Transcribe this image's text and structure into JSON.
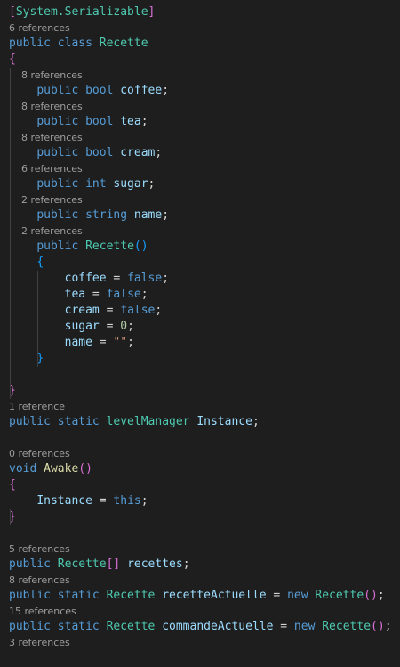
{
  "colors": {
    "background": "#1e1e1e",
    "keyword": "#569cd6",
    "type": "#4ec9b0",
    "function": "#dcdcaa",
    "identifier": "#9cdcfe",
    "punctuation": "#d4d4d4",
    "number": "#b5cea8",
    "string": "#ce9178",
    "codelens": "#9d9d9d",
    "bracket_level1": "#da70d6",
    "bracket_level2": "#179fff",
    "bracket_level3": "#ffd700"
  },
  "lines": [
    {
      "kind": "code",
      "tokens": [
        {
          "t": "[",
          "c": "br1"
        },
        {
          "t": "System.Serializable",
          "c": "ty"
        },
        {
          "t": "]",
          "c": "br1"
        }
      ]
    },
    {
      "kind": "lens",
      "text": "6 references"
    },
    {
      "kind": "code",
      "tokens": [
        {
          "t": "public class ",
          "c": "kw"
        },
        {
          "t": "Recette",
          "c": "ty"
        }
      ]
    },
    {
      "kind": "code",
      "tokens": [
        {
          "t": "{",
          "c": "br1"
        }
      ]
    },
    {
      "kind": "lens",
      "text": "    8 references"
    },
    {
      "kind": "code",
      "tokens": [
        {
          "t": "    ",
          "c": "pn"
        },
        {
          "t": "public bool ",
          "c": "kw"
        },
        {
          "t": "coffee",
          "c": "id"
        },
        {
          "t": ";",
          "c": "pn"
        }
      ]
    },
    {
      "kind": "lens",
      "text": "    8 references"
    },
    {
      "kind": "code",
      "tokens": [
        {
          "t": "    ",
          "c": "pn"
        },
        {
          "t": "public bool ",
          "c": "kw"
        },
        {
          "t": "tea",
          "c": "id"
        },
        {
          "t": ";",
          "c": "pn"
        }
      ]
    },
    {
      "kind": "lens",
      "text": "    8 references"
    },
    {
      "kind": "code",
      "tokens": [
        {
          "t": "    ",
          "c": "pn"
        },
        {
          "t": "public bool ",
          "c": "kw"
        },
        {
          "t": "cream",
          "c": "id"
        },
        {
          "t": ";",
          "c": "pn"
        }
      ]
    },
    {
      "kind": "lens",
      "text": "    6 references"
    },
    {
      "kind": "code",
      "tokens": [
        {
          "t": "    ",
          "c": "pn"
        },
        {
          "t": "public int ",
          "c": "kw"
        },
        {
          "t": "sugar",
          "c": "id"
        },
        {
          "t": ";",
          "c": "pn"
        }
      ]
    },
    {
      "kind": "lens",
      "text": "    2 references"
    },
    {
      "kind": "code",
      "tokens": [
        {
          "t": "    ",
          "c": "pn"
        },
        {
          "t": "public string ",
          "c": "kw"
        },
        {
          "t": "name",
          "c": "id"
        },
        {
          "t": ";",
          "c": "pn"
        }
      ]
    },
    {
      "kind": "lens",
      "text": "    2 references"
    },
    {
      "kind": "code",
      "tokens": [
        {
          "t": "    ",
          "c": "pn"
        },
        {
          "t": "public ",
          "c": "kw"
        },
        {
          "t": "Recette",
          "c": "ty"
        },
        {
          "t": "()",
          "c": "br2"
        }
      ]
    },
    {
      "kind": "code",
      "tokens": [
        {
          "t": "    ",
          "c": "pn"
        },
        {
          "t": "{",
          "c": "br2"
        }
      ]
    },
    {
      "kind": "code",
      "tokens": [
        {
          "t": "        ",
          "c": "pn"
        },
        {
          "t": "coffee",
          "c": "id"
        },
        {
          "t": " = ",
          "c": "pn"
        },
        {
          "t": "false",
          "c": "kw"
        },
        {
          "t": ";",
          "c": "pn"
        }
      ]
    },
    {
      "kind": "code",
      "tokens": [
        {
          "t": "        ",
          "c": "pn"
        },
        {
          "t": "tea",
          "c": "id"
        },
        {
          "t": " = ",
          "c": "pn"
        },
        {
          "t": "false",
          "c": "kw"
        },
        {
          "t": ";",
          "c": "pn"
        }
      ]
    },
    {
      "kind": "code",
      "tokens": [
        {
          "t": "        ",
          "c": "pn"
        },
        {
          "t": "cream",
          "c": "id"
        },
        {
          "t": " = ",
          "c": "pn"
        },
        {
          "t": "false",
          "c": "kw"
        },
        {
          "t": ";",
          "c": "pn"
        }
      ]
    },
    {
      "kind": "code",
      "tokens": [
        {
          "t": "        ",
          "c": "pn"
        },
        {
          "t": "sugar",
          "c": "id"
        },
        {
          "t": " = ",
          "c": "pn"
        },
        {
          "t": "0",
          "c": "num"
        },
        {
          "t": ";",
          "c": "pn"
        }
      ]
    },
    {
      "kind": "code",
      "tokens": [
        {
          "t": "        ",
          "c": "pn"
        },
        {
          "t": "name",
          "c": "id"
        },
        {
          "t": " = ",
          "c": "pn"
        },
        {
          "t": "\"\"",
          "c": "str"
        },
        {
          "t": ";",
          "c": "pn"
        }
      ]
    },
    {
      "kind": "code",
      "tokens": [
        {
          "t": "    ",
          "c": "pn"
        },
        {
          "t": "}",
          "c": "br2"
        }
      ]
    },
    {
      "kind": "code",
      "tokens": []
    },
    {
      "kind": "code",
      "tokens": [
        {
          "t": "}",
          "c": "br1"
        }
      ]
    },
    {
      "kind": "lens",
      "text": "1 reference"
    },
    {
      "kind": "code",
      "tokens": [
        {
          "t": "public static ",
          "c": "kw"
        },
        {
          "t": "levelManager",
          "c": "ty"
        },
        {
          "t": " ",
          "c": "pn"
        },
        {
          "t": "Instance",
          "c": "id"
        },
        {
          "t": ";",
          "c": "pn"
        }
      ]
    },
    {
      "kind": "code",
      "tokens": []
    },
    {
      "kind": "lens",
      "text": "0 references"
    },
    {
      "kind": "code",
      "tokens": [
        {
          "t": "void ",
          "c": "kw"
        },
        {
          "t": "Awake",
          "c": "fn"
        },
        {
          "t": "()",
          "c": "br1"
        }
      ]
    },
    {
      "kind": "code",
      "tokens": [
        {
          "t": "{",
          "c": "br1"
        }
      ]
    },
    {
      "kind": "code",
      "tokens": [
        {
          "t": "    ",
          "c": "pn"
        },
        {
          "t": "Instance",
          "c": "id"
        },
        {
          "t": " = ",
          "c": "pn"
        },
        {
          "t": "this",
          "c": "kw"
        },
        {
          "t": ";",
          "c": "pn"
        }
      ]
    },
    {
      "kind": "code",
      "tokens": [
        {
          "t": "}",
          "c": "br1"
        }
      ]
    },
    {
      "kind": "code",
      "tokens": []
    },
    {
      "kind": "lens",
      "text": "5 references"
    },
    {
      "kind": "code",
      "tokens": [
        {
          "t": "public ",
          "c": "kw"
        },
        {
          "t": "Recette",
          "c": "ty"
        },
        {
          "t": "[]",
          "c": "br1"
        },
        {
          "t": " ",
          "c": "pn"
        },
        {
          "t": "recettes",
          "c": "id"
        },
        {
          "t": ";",
          "c": "pn"
        }
      ]
    },
    {
      "kind": "lens",
      "text": "8 references"
    },
    {
      "kind": "code",
      "tokens": [
        {
          "t": "public static ",
          "c": "kw"
        },
        {
          "t": "Recette",
          "c": "ty"
        },
        {
          "t": " ",
          "c": "pn"
        },
        {
          "t": "recetteActuelle",
          "c": "id"
        },
        {
          "t": " = ",
          "c": "pn"
        },
        {
          "t": "new ",
          "c": "kw"
        },
        {
          "t": "Recette",
          "c": "ty"
        },
        {
          "t": "()",
          "c": "br1"
        },
        {
          "t": ";",
          "c": "pn"
        }
      ]
    },
    {
      "kind": "lens",
      "text": "15 references"
    },
    {
      "kind": "code",
      "tokens": [
        {
          "t": "public static ",
          "c": "kw"
        },
        {
          "t": "Recette",
          "c": "ty"
        },
        {
          "t": " ",
          "c": "pn"
        },
        {
          "t": "commandeActuelle",
          "c": "id"
        },
        {
          "t": " = ",
          "c": "pn"
        },
        {
          "t": "new ",
          "c": "kw"
        },
        {
          "t": "Recette",
          "c": "ty"
        },
        {
          "t": "()",
          "c": "br1"
        },
        {
          "t": ";",
          "c": "pn"
        }
      ]
    },
    {
      "kind": "lens",
      "text": "3 references"
    }
  ]
}
